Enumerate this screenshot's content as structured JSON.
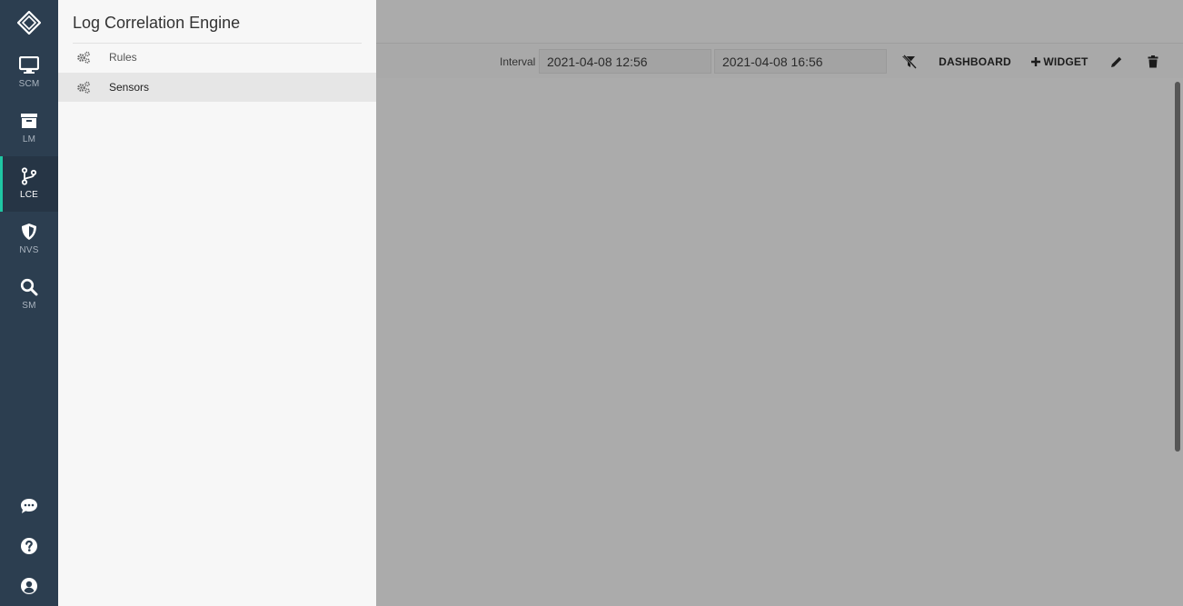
{
  "rail": {
    "items": [
      {
        "label": "SCM",
        "icon": "monitor-icon"
      },
      {
        "label": "LM",
        "icon": "archive-icon"
      },
      {
        "label": "LCE",
        "icon": "branch-icon",
        "active": true
      },
      {
        "label": "NVS",
        "icon": "shield-icon"
      },
      {
        "label": "SM",
        "icon": "search-icon"
      }
    ],
    "bottom": [
      "chat-icon",
      "help-icon",
      "user-icon"
    ]
  },
  "drawer": {
    "title": "Log Correlation Engine",
    "items": [
      {
        "label": "Rules",
        "icon": "gears-icon"
      },
      {
        "label": "Sensors",
        "icon": "gears-icon",
        "selected": true
      }
    ]
  },
  "toolbar": {
    "interval_label": "Interval",
    "from": "2021-04-08 12:56",
    "to": "2021-04-08 16:56",
    "dashboard_label": "DASHBOARD",
    "widget_label": "WIDGET"
  },
  "colors": {
    "rail_bg": "#2c3e50",
    "accent": "#1fc6a3",
    "drawer_bg": "#f7f7f7",
    "overlay_bg": "#ababab"
  }
}
